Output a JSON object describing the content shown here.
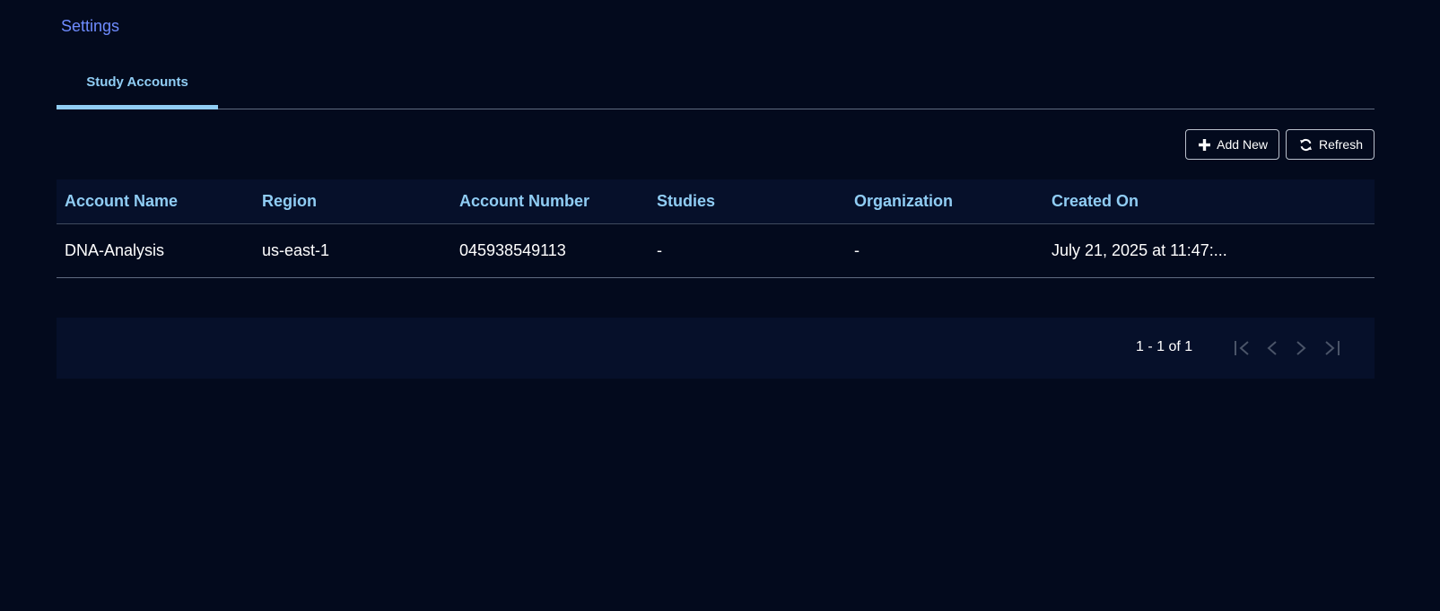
{
  "breadcrumb": {
    "label": "Settings"
  },
  "tabs": [
    {
      "label": "Study Accounts",
      "active": true
    }
  ],
  "toolbar": {
    "add_label": "Add New",
    "add_icon": "plus-icon",
    "refresh_label": "Refresh",
    "refresh_icon": "refresh-icon"
  },
  "table": {
    "columns": [
      "Account Name",
      "Region",
      "Account Number",
      "Studies",
      "Organization",
      "Created On"
    ],
    "rows": [
      {
        "account_name": "DNA-Analysis",
        "region": "us-east-1",
        "account_number": "045938549113",
        "studies": "-",
        "organization": "-",
        "created_on": "July 21, 2025 at 11:47:...",
        "action_icon": "more-vertical-icon"
      }
    ]
  },
  "pagination": {
    "range_text": "1 - 1 of 1",
    "icons": [
      "first-page-icon",
      "previous-page-icon",
      "next-page-icon",
      "last-page-icon"
    ]
  },
  "colors": {
    "background": "#030a1d",
    "surface": "#06102a",
    "accent": "#90cdf4",
    "link": "#6f8cff",
    "disabled": "#4a5468"
  }
}
